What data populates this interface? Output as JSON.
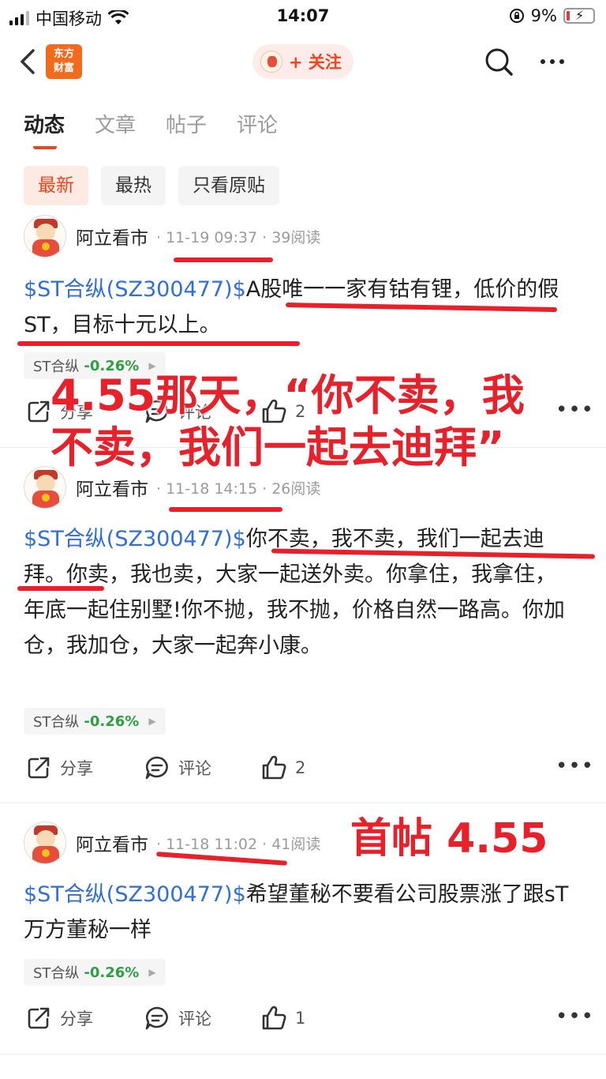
{
  "status_bar": {
    "carrier": "中国移动",
    "time": "14:07",
    "battery": "9%"
  },
  "nav": {
    "logo_line1": "东方",
    "logo_line2": "财富",
    "follow_label": "+ 关注"
  },
  "tabs": [
    {
      "label": "动态",
      "active": true
    },
    {
      "label": "文章",
      "active": false
    },
    {
      "label": "帖子",
      "active": false
    },
    {
      "label": "评论",
      "active": false
    }
  ],
  "filters": [
    {
      "label": "最新",
      "active": true
    },
    {
      "label": "最热",
      "active": false
    },
    {
      "label": "只看原贴",
      "active": false
    }
  ],
  "posts": [
    {
      "author": "阿立看市",
      "meta": "· 11-19 09:37 · 39阅读",
      "stock_link": "$ST合纵(SZ300477)$",
      "text": "A股唯一一家有钴有锂，低价的假ST，目标十元以上。",
      "tag_name": "ST合纵",
      "tag_change": "-0.26%",
      "share_label": "分享",
      "comment_label": "评论",
      "like_count": "2"
    },
    {
      "author": "阿立看市",
      "meta": "· 11-18 14:15 · 26阅读",
      "stock_link": "$ST合纵(SZ300477)$",
      "text": "你不卖，我不卖，我们一起去迪拜。你卖，我也卖，大家一起送外卖。你拿住，我拿住，年底一起住别墅!你不抛，我不抛，价格自然一路高。你加仓，我加仓，大家一起奔小康。",
      "tag_name": "ST合纵",
      "tag_change": "-0.26%",
      "share_label": "分享",
      "comment_label": "评论",
      "like_count": "2"
    },
    {
      "author": "阿立看市",
      "meta": "· 11-18 11:02 · 41阅读",
      "stock_link": "$ST合纵(SZ300477)$",
      "text": "希望董秘不要看公司股票涨了跟sT万方董秘一样",
      "tag_name": "ST合纵",
      "tag_change": "-0.26%",
      "share_label": "分享",
      "comment_label": "评论",
      "like_count": "1"
    }
  ],
  "annotations": {
    "overlay_main_line1": "4.55那天，“你不卖，我",
    "overlay_main_line2": "不卖，我们一起去迪拜”",
    "overlay_first_post": "首帖 4.55",
    "color": "#e8202a"
  },
  "colors": {
    "accent": "#f0441c",
    "stock_link": "#2f6fd6",
    "change_green": "#2ea043"
  }
}
